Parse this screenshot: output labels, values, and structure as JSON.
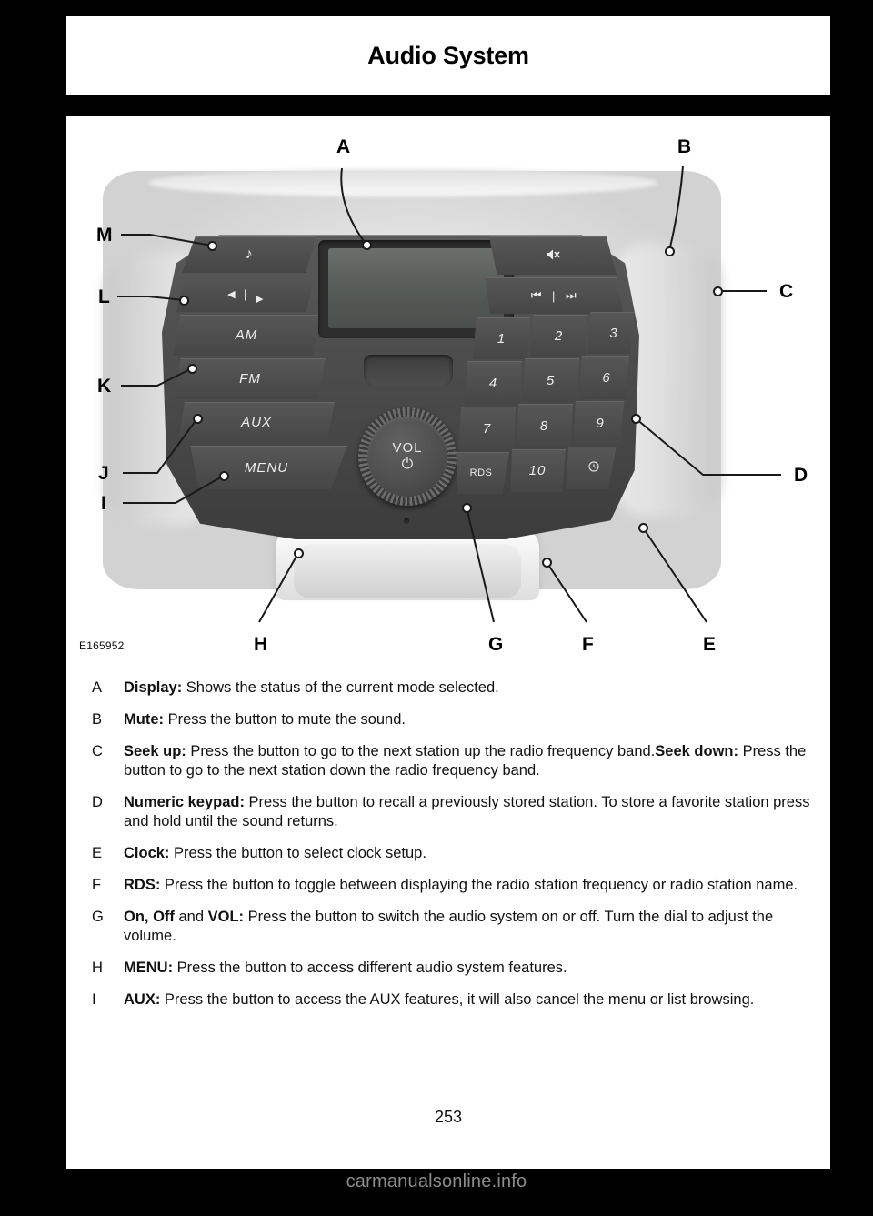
{
  "header": {
    "title": "Audio System"
  },
  "figure": {
    "id_label": "E165952",
    "callouts": [
      "A",
      "B",
      "C",
      "D",
      "E",
      "F",
      "G",
      "H",
      "I",
      "J",
      "K",
      "L",
      "M"
    ],
    "unit_labels": {
      "music_note": "♪",
      "prev_arrow": "◀",
      "separator": "|",
      "next_arrow": "▶",
      "am": "AM",
      "fm": "FM",
      "aux": "AUX",
      "menu": "MENU",
      "mute": "🔇",
      "seek_down": "⏮",
      "seek_up": "⏭",
      "vol": "VOL",
      "power": "⏻",
      "rds": "RDS",
      "clock": "⏱"
    },
    "keypad": [
      "1",
      "2",
      "3",
      "4",
      "5",
      "6",
      "7",
      "8",
      "9",
      "10"
    ]
  },
  "descriptions": [
    {
      "key": "A",
      "bold": "Display:",
      "text": " Shows the status of the current mode selected."
    },
    {
      "key": "B",
      "bold": "Mute:",
      "text": " Press the button to mute the sound."
    },
    {
      "key": "C",
      "bold": "Seek up:",
      "text": " Press the button to go to the next station up the radio frequency band.",
      "bold2": "Seek down:",
      "text2": " Press the button to go to the next station down the radio frequency band."
    },
    {
      "key": "D",
      "bold": "Numeric keypad:",
      "text": " Press the button to recall a previously stored station. To store a favorite station press and hold until the sound returns."
    },
    {
      "key": "E",
      "bold": "Clock:",
      "text": " Press the button to select clock setup."
    },
    {
      "key": "F",
      "bold": "RDS:",
      "text": " Press the button to toggle between displaying the radio station frequency or radio station name."
    },
    {
      "key": "G",
      "bold": "On, Off",
      "mid": " and ",
      "bold2": "VOL:",
      "text2": " Press the button to switch the audio system on or off. Turn the dial to adjust the volume."
    },
    {
      "key": "H",
      "bold": "MENU:",
      "text": " Press the button to access different audio system features."
    },
    {
      "key": "I",
      "bold": "AUX:",
      "text": " Press the button to access the AUX features, it will also cancel the menu or list browsing."
    }
  ],
  "page_number": "253",
  "watermark": "carmanualsonline.info"
}
